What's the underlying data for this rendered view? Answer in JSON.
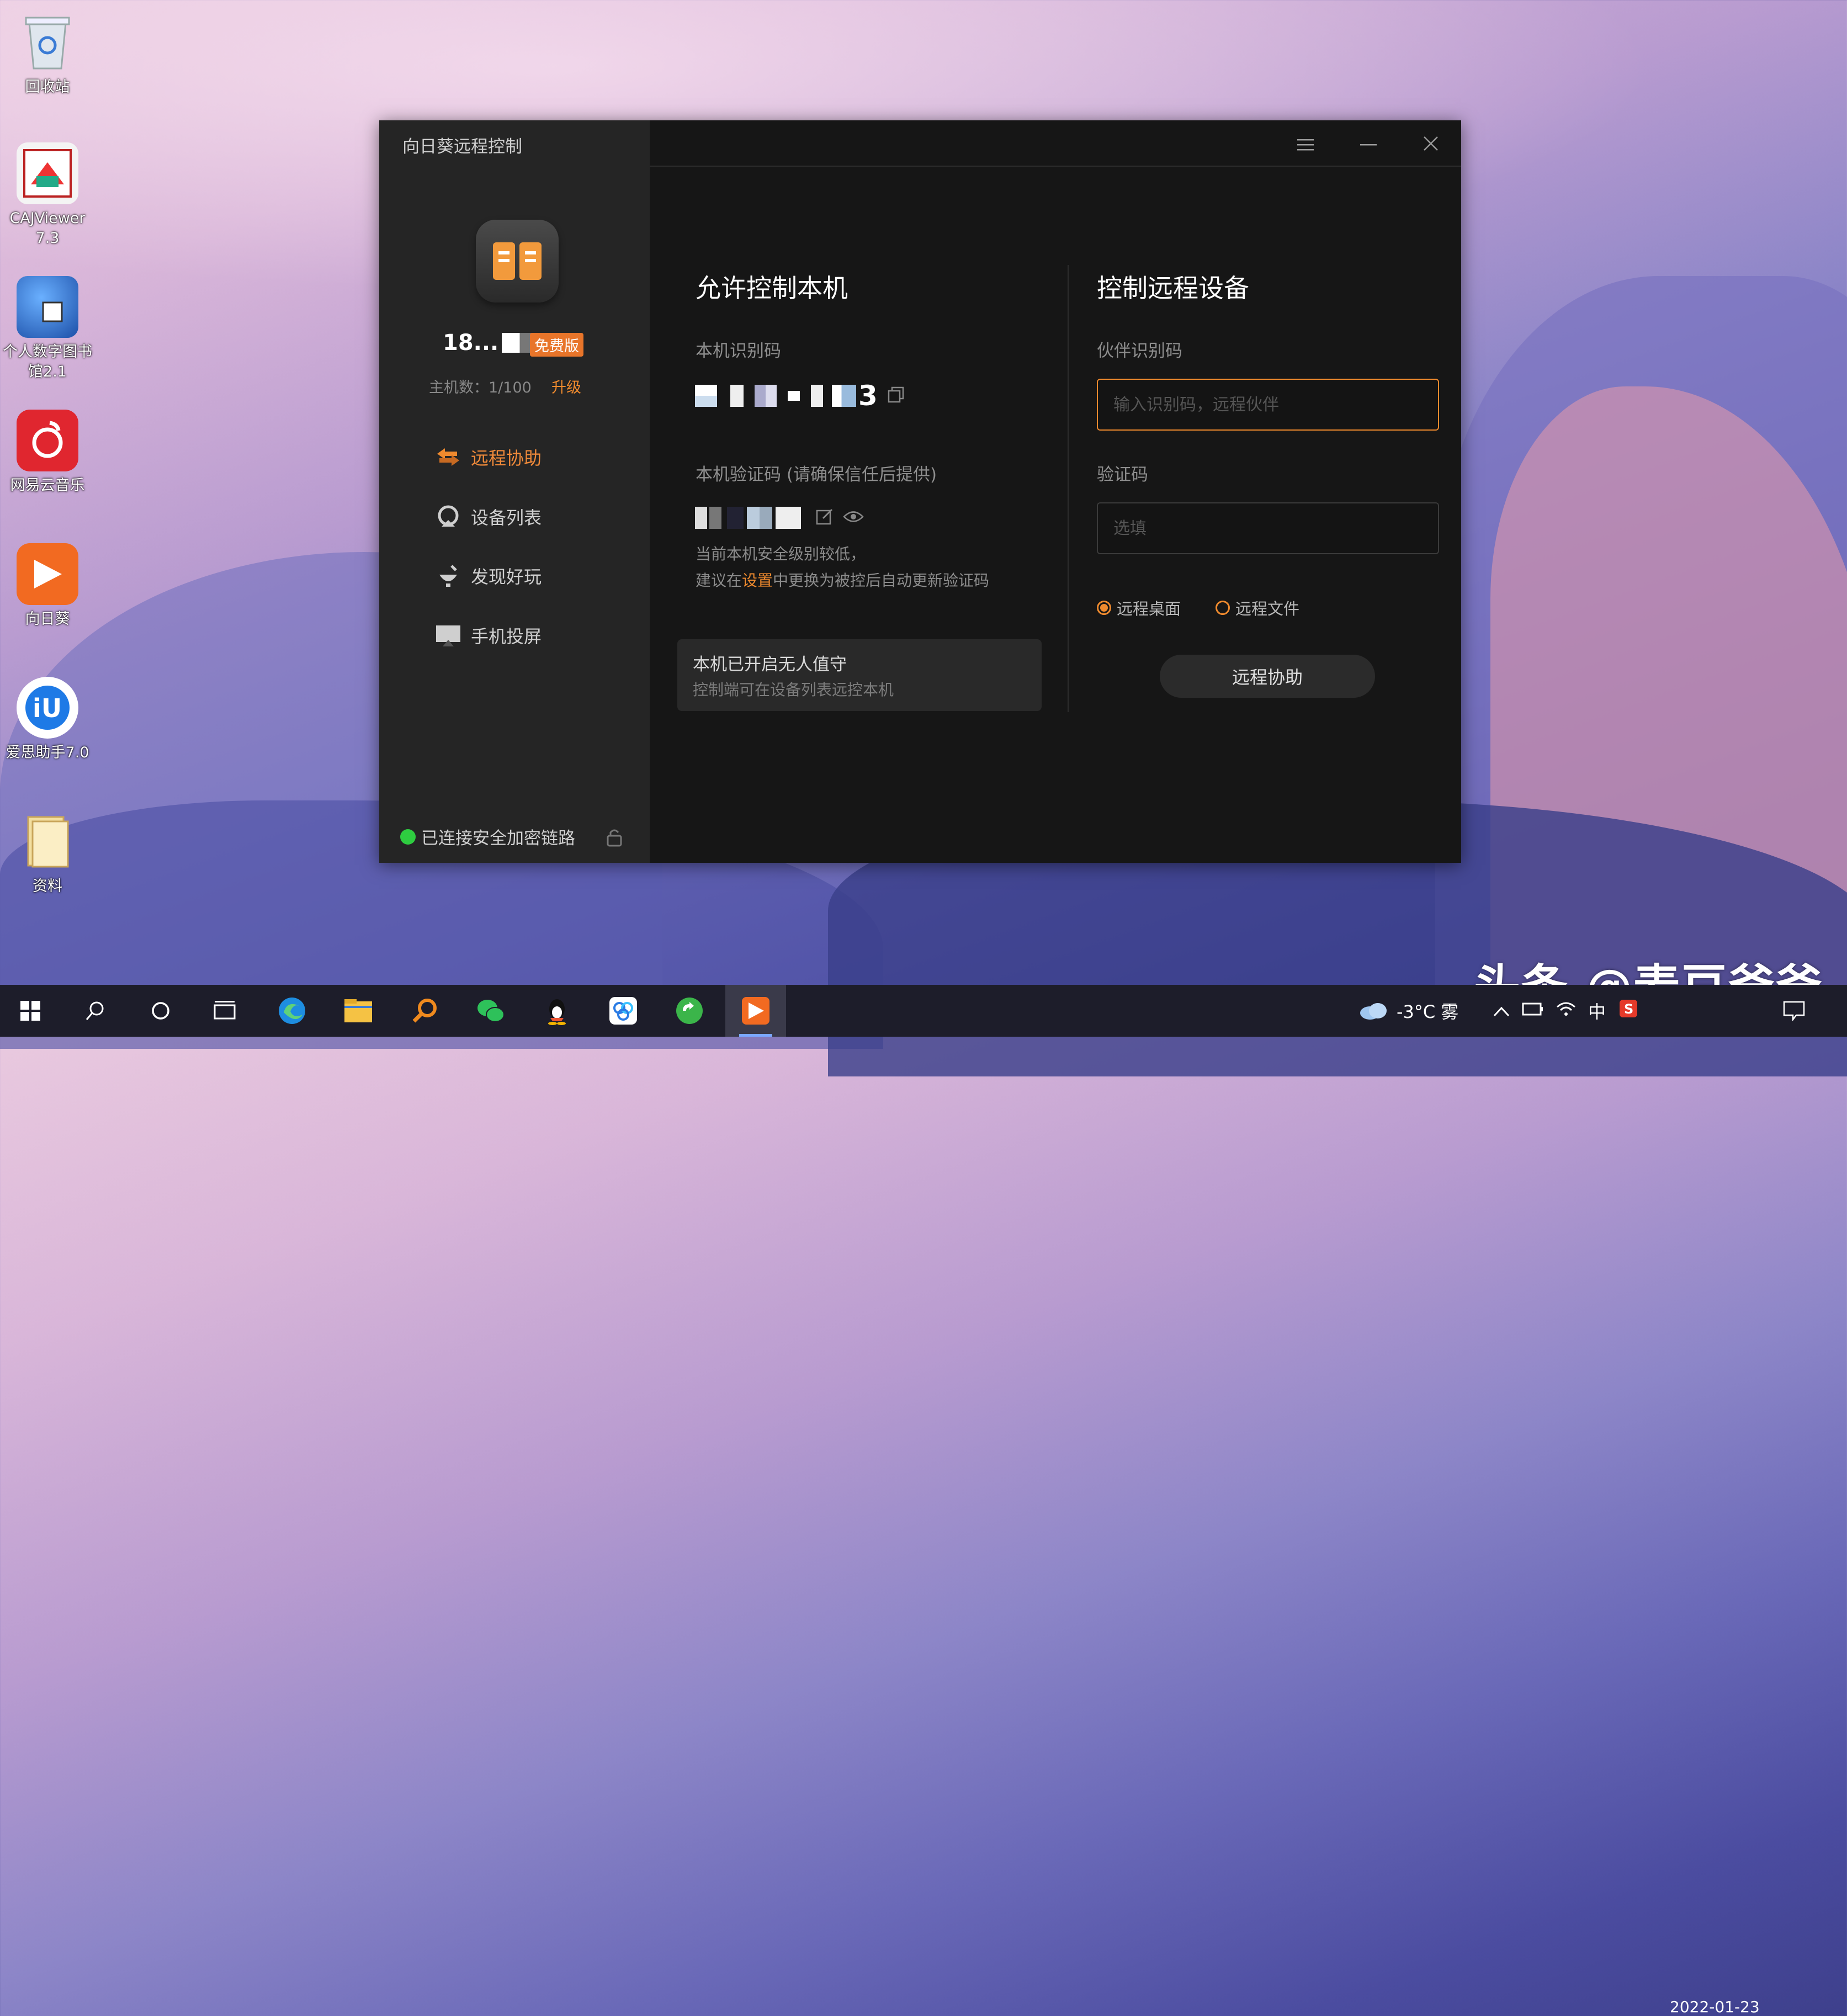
{
  "desktop": {
    "icons": [
      {
        "label": "回收站"
      },
      {
        "label": "CAJViewer 7.3"
      },
      {
        "label": "个人数字图书馆2.1"
      },
      {
        "label": "网易云音乐"
      },
      {
        "label": "向日葵"
      },
      {
        "label": "爱思助手7.0"
      },
      {
        "label": "资料"
      }
    ]
  },
  "window": {
    "title": "向日葵远程控制",
    "menu_icon": "hamburger-icon",
    "minimize_icon": "minimize-icon",
    "close_icon": "close-icon"
  },
  "sidebar": {
    "user_id_prefix": "18...",
    "badge": "免费版",
    "host_count": "主机数：1/100",
    "upgrade": "升级",
    "nav": [
      {
        "label": "远程协助",
        "icon": "remote-assist-icon",
        "active": true
      },
      {
        "label": "设备列表",
        "icon": "device-list-icon",
        "active": false
      },
      {
        "label": "发现好玩",
        "icon": "discover-icon",
        "active": false
      },
      {
        "label": "手机投屏",
        "icon": "phone-cast-icon",
        "active": false
      }
    ],
    "secure_status": "已连接安全加密链路"
  },
  "allow": {
    "title": "允许控制本机",
    "id_label": "本机识别码",
    "id_suffix": "3",
    "code_label": "本机验证码 (请确保信任后提供)",
    "hint_line1": "当前本机安全级别较低，",
    "hint_pre": "建议在",
    "hint_link": "设置",
    "hint_post": "中更换为被控后自动更新验证码",
    "notice_title": "本机已开启无人值守",
    "notice_sub": "控制端可在设备列表远控本机"
  },
  "control": {
    "title": "控制远程设备",
    "partner_label": "伙伴识别码",
    "partner_placeholder": "输入识别码，远程伙伴",
    "code_label": "验证码",
    "code_placeholder": "选填",
    "radio_desktop": "远程桌面",
    "radio_file": "远程文件",
    "assist_button": "远程协助"
  },
  "taskbar": {
    "weather": "-3°C 雾",
    "date": "2022-01-23",
    "ime": "中"
  },
  "watermark": "头条 @麦豆爸爸",
  "colors": {
    "accent": "#ef8a2e",
    "badge": "#e8752a",
    "secure": "#2ecc40"
  }
}
